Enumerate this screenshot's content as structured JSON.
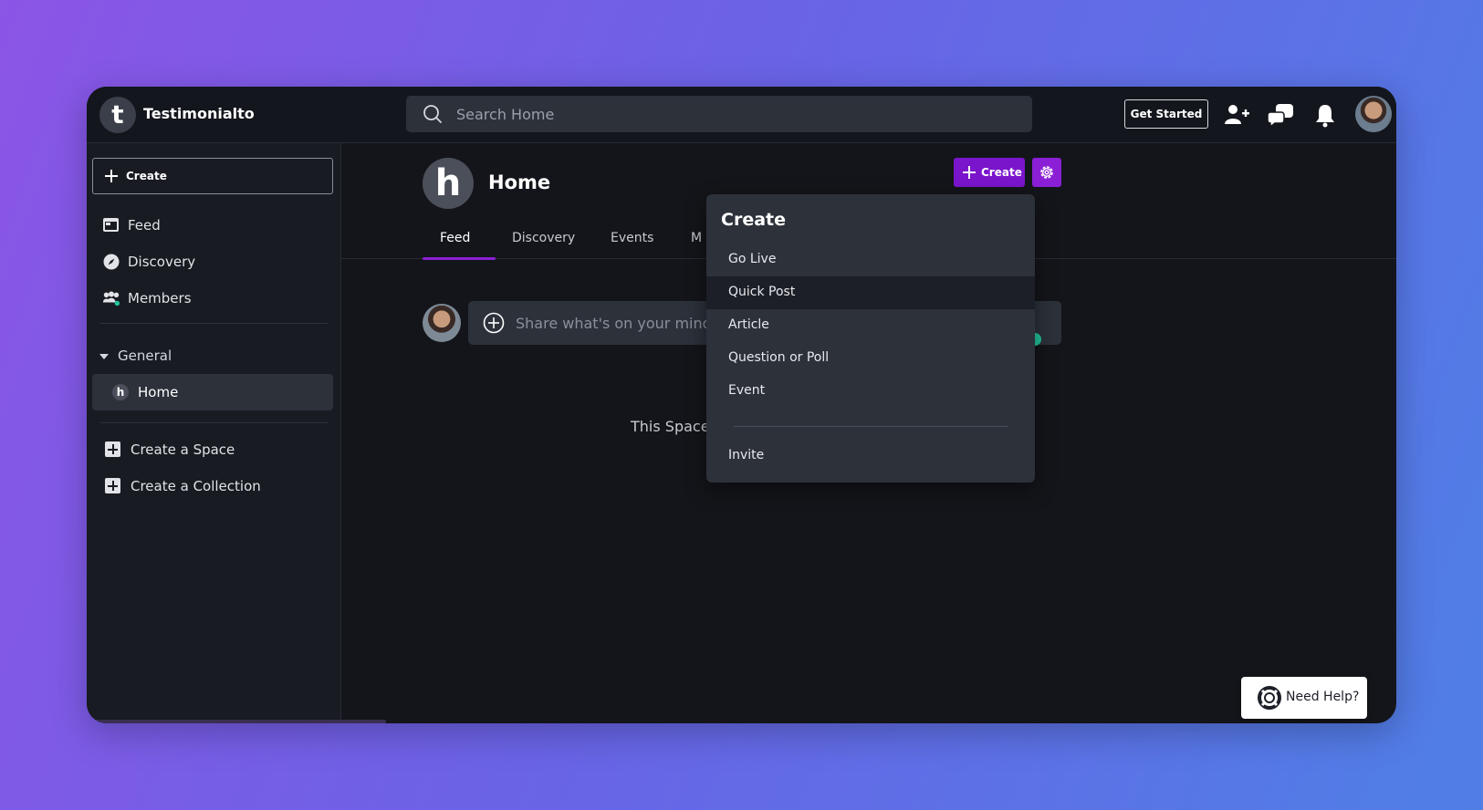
{
  "app": {
    "brand": "Testimonialto",
    "logo_letter": "t"
  },
  "topbar": {
    "search_placeholder": "Search Home",
    "get_started_label": "Get Started",
    "icons": [
      "add-user-icon",
      "chat-icon",
      "bell-icon",
      "avatar"
    ]
  },
  "sidebar": {
    "create_label": "Create",
    "nav": [
      {
        "label": "Feed",
        "icon": "feed-icon"
      },
      {
        "label": "Discovery",
        "icon": "compass-icon"
      },
      {
        "label": "Members",
        "icon": "members-icon"
      }
    ],
    "group_label": "General",
    "home_item": {
      "label": "Home",
      "badge": "h"
    },
    "links": [
      {
        "label": "Create a Space"
      },
      {
        "label": "Create a Collection"
      }
    ]
  },
  "main": {
    "space_badge": "h",
    "space_title": "Home",
    "create_label": "Create",
    "tabs": [
      {
        "label": "Feed",
        "active": true
      },
      {
        "label": "Discovery"
      },
      {
        "label": "Events"
      },
      {
        "label": "M"
      }
    ],
    "composer_placeholder": "Share what's on your mind...",
    "empty_text": "This Space"
  },
  "dropdown": {
    "title": "Create",
    "items": [
      "Go Live",
      "Quick Post",
      "Article",
      "Question or Poll",
      "Event"
    ],
    "hovered_item": "Quick Post",
    "footer_item": "Invite"
  },
  "help": {
    "label": "Need Help?"
  },
  "colors": {
    "accent": "#7b15cc",
    "online": "#22c39a",
    "background": "#14151a"
  }
}
